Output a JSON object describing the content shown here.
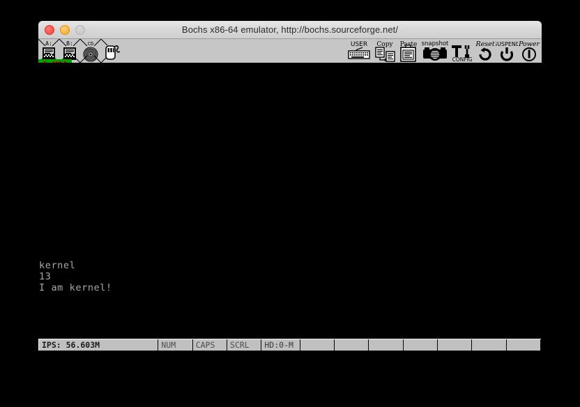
{
  "window": {
    "title": "Bochs x86-64 emulator, http://bochs.sourceforge.net/",
    "controls": {
      "close_label": "close",
      "minimize_label": "minimize",
      "zoom_label": "zoom"
    }
  },
  "toolbar": {
    "left_buttons": [
      {
        "name": "floppy-a-button",
        "label": "A:",
        "icon": "floppy-a-icon"
      },
      {
        "name": "floppy-b-button",
        "label": "B:",
        "icon": "floppy-b-icon"
      },
      {
        "name": "cdrom-button",
        "label": "CD",
        "icon": "cdrom-icon"
      },
      {
        "name": "mouse-button",
        "label": "",
        "icon": "mouse-icon"
      }
    ],
    "right_buttons": [
      {
        "name": "user-button",
        "label": "USER",
        "icon": "keyboard-icon"
      },
      {
        "name": "copy-button",
        "label": "Copy",
        "icon": "copy-icon"
      },
      {
        "name": "paste-button",
        "label": "Paste",
        "icon": "paste-icon"
      },
      {
        "name": "snapshot-button",
        "label": "snapshot",
        "icon": "camera-icon"
      },
      {
        "name": "config-button",
        "label": "CONFIG",
        "icon": "tools-icon"
      },
      {
        "name": "reset-button",
        "label": "Reset",
        "icon": "reset-icon"
      },
      {
        "name": "suspend-button",
        "label": "SUSPEND",
        "icon": "suspend-icon"
      },
      {
        "name": "power-button",
        "label": "Power",
        "icon": "power-icon"
      }
    ]
  },
  "media_strip": {
    "text": "1 MBA",
    "background_color": "#00a000",
    "text_color": "#b00000"
  },
  "screen": {
    "lines": [
      "kernel",
      "13",
      "I am kernel!"
    ],
    "text": "kernel\n13\nI am kernel!",
    "cursor": "_",
    "background_color": "#000000",
    "text_color": "#a8a8a8"
  },
  "statusbar": {
    "ips": "IPS: 56.603M",
    "num": "NUM",
    "caps": "CAPS",
    "scrl": "SCRL",
    "hd": "HD:0-M",
    "empty_cells": [
      "",
      "",
      "",
      "",
      "",
      "",
      ""
    ]
  }
}
